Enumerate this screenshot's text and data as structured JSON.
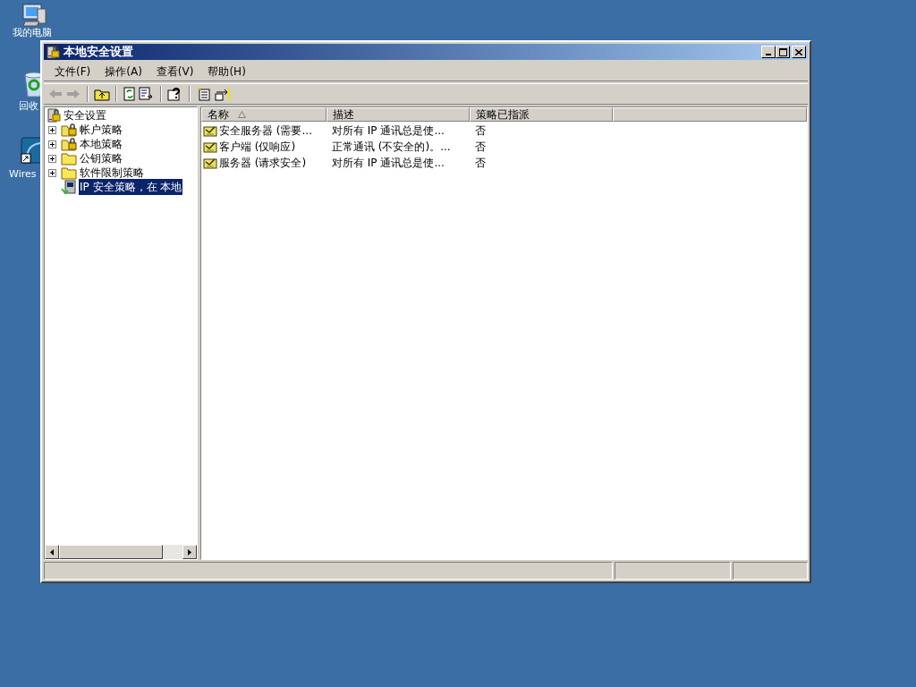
{
  "desktop_icons": [
    {
      "kind": "computer",
      "label": "我的电脑"
    },
    {
      "kind": "recycle",
      "label": "回收"
    },
    {
      "kind": "shortcut",
      "label": "Wires"
    }
  ],
  "window": {
    "title": "本地安全设置"
  },
  "menu": [
    {
      "label": "文件(F)"
    },
    {
      "label": "操作(A)"
    },
    {
      "label": "查看(V)"
    },
    {
      "label": "帮助(H)"
    }
  ],
  "tree": {
    "label": "安全设置",
    "kind": "root",
    "children": [
      {
        "label": "帐户策略",
        "kind": "lock-folder",
        "collapsed": true,
        "selected": false
      },
      {
        "label": "本地策略",
        "kind": "lock-folder",
        "collapsed": true,
        "selected": false
      },
      {
        "label": "公钥策略",
        "kind": "folder",
        "collapsed": true,
        "selected": false
      },
      {
        "label": "软件限制策略",
        "kind": "folder",
        "collapsed": true,
        "selected": false
      },
      {
        "label": "IP 安全策略，在 本地",
        "kind": "ip",
        "collapsed": false,
        "selected": true
      }
    ]
  },
  "table": {
    "columns": [
      "名称",
      "描述",
      "策略已指派"
    ],
    "rows": [
      [
        "安全服务器 (需要...",
        "对所有 IP 通讯总是使...",
        "否"
      ],
      [
        "客户端 (仅响应)",
        "正常通讯 (不安全的)。...",
        "否"
      ],
      [
        "服务器 (请求安全)",
        "对所有 IP 通讯总是使...",
        "否"
      ]
    ]
  }
}
